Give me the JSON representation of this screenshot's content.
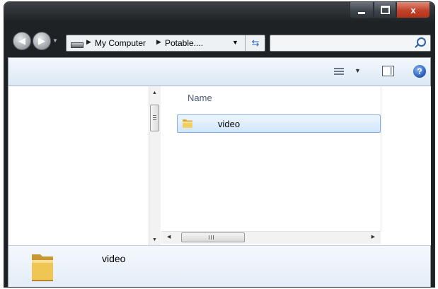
{
  "window": {
    "title": "",
    "controls": {
      "minimize_icon": "minimize-icon",
      "maximize_icon": "maximize-icon",
      "close_glyph": "x"
    }
  },
  "nav": {
    "back_icon": "back-arrow-icon",
    "forward_icon": "forward-arrow-icon",
    "breadcrumb": [
      "My Computer",
      "Potable...."
    ],
    "search_placeholder": ""
  },
  "toolbar": {
    "views_icon": "views-icon",
    "preview_pane_icon": "preview-pane-icon",
    "help_glyph": "?"
  },
  "file_list": {
    "column_header": "Name",
    "items": [
      {
        "name": "video",
        "type": "folder",
        "selected": true
      }
    ]
  },
  "details_pane": {
    "name": "video",
    "icon": "folder-icon"
  },
  "scrollbars": {
    "horizontal_grip": "III"
  }
}
